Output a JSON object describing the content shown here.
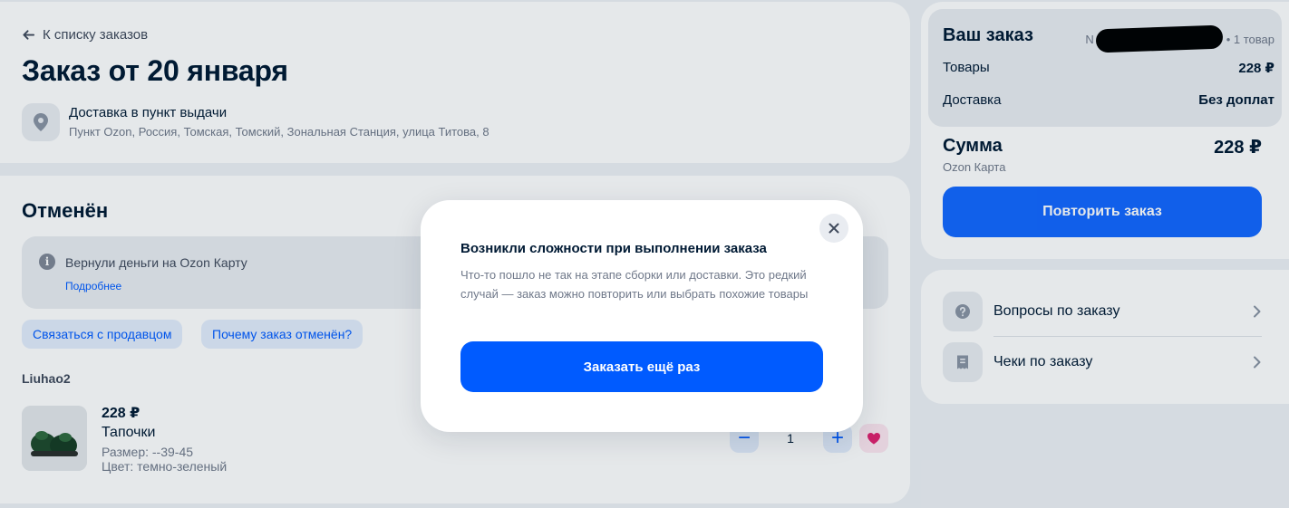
{
  "header": {
    "back_link": "К списку заказов",
    "title": "Заказ от 20 января",
    "delivery": {
      "title": "Доставка в пункт выдачи",
      "address": "Пункт Ozon, Россия, Томская, Томский, Зональная Станция, улица Титова, 8"
    }
  },
  "status": {
    "title": "Отменён",
    "info_text": "Вернули деньги на Ozon Карту",
    "info_link": "Подробнее",
    "actions": [
      "Связаться с продавцом",
      "Почему заказ отменён?"
    ],
    "seller": "Liuhao2",
    "product": {
      "price": "228 ₽",
      "name": "Тапочки",
      "size": "Размер: --39-45",
      "color": "Цвет: темно-зеленый",
      "quantity": "1",
      "minus": "−",
      "plus": "+"
    }
  },
  "summary": {
    "title": "Ваш заказ",
    "order_number_prefix": "N",
    "items_count": "• 1 товар",
    "rows": [
      {
        "label": "Товары",
        "value": "228 ₽"
      },
      {
        "label": "Доставка",
        "value": "Без доплат"
      }
    ],
    "total_label": "Сумма",
    "total_value": "228 ₽",
    "payment_method": "Ozon Карта",
    "repeat_button": "Повторить заказ"
  },
  "links": [
    {
      "label": "Вопросы по заказу",
      "icon": "question-icon"
    },
    {
      "label": "Чеки по заказу",
      "icon": "receipt-icon"
    }
  ],
  "modal": {
    "title": "Возникли сложности при выполнении заказа",
    "text": "Что-то пошло не так на этапе сборки или доставки. Это редкий случай — заказ можно повторить или выбрать похожие товары",
    "button": "Заказать ещё раз",
    "close_icon": "close-icon"
  },
  "colors": {
    "accent": "#005bff",
    "text_primary": "#001a34",
    "text_secondary": "#70798a",
    "background": "#eef1f5",
    "favorite": "#e0216f"
  }
}
